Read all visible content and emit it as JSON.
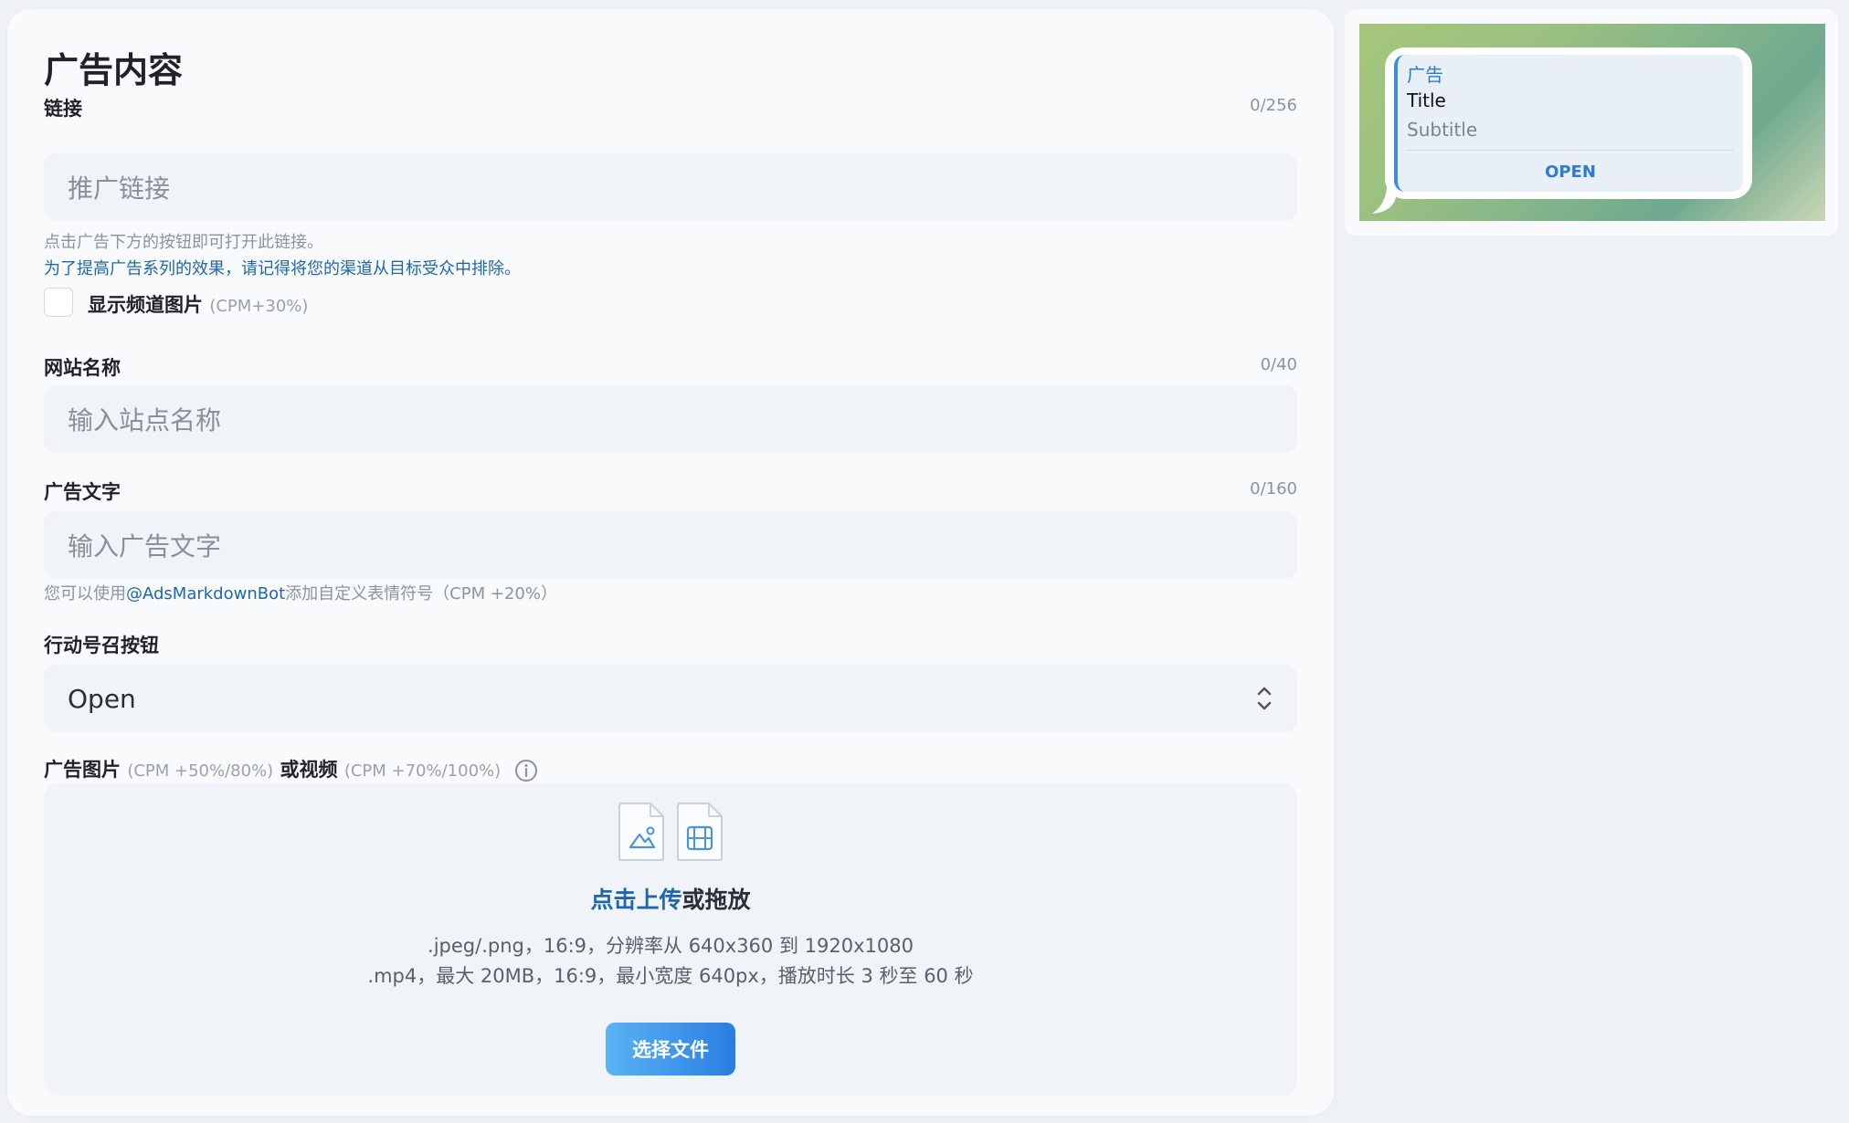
{
  "form": {
    "title": "广告内容",
    "link": {
      "label": "链接",
      "counter": "0/256",
      "placeholder": "推广链接",
      "hint": "点击广告下方的按钮即可打开此链接。",
      "hint_blue": "为了提高广告系列的效果，请记得将您的渠道从目标受众中排除。"
    },
    "show_channel_image": {
      "label": "显示频道图片",
      "cpm": "(CPM+30%)",
      "checked": false
    },
    "site_name": {
      "label": "网站名称",
      "counter": "0/40",
      "placeholder": "输入站点名称"
    },
    "ad_text": {
      "label": "广告文字",
      "counter": "0/160",
      "placeholder": "输入广告文字",
      "hint_prefix": "您可以使用",
      "hint_link": "@AdsMarkdownBot",
      "hint_suffix": "添加自定义表情符号（CPM +20%）"
    },
    "cta": {
      "label": "行动号召按钮",
      "selected": "Open"
    },
    "media": {
      "label_image": "广告图片",
      "cpm_image": "(CPM +50%/80%)",
      "label_or_video": "或视频",
      "cpm_video": "(CPM +70%/100%)",
      "upload_link": "点击上传",
      "upload_suffix": "或拖放",
      "line1": ".jpeg/.png，16:9，分辨率从 640x360 到 1920x1080",
      "line2": ".mp4，最大 20MB，16:9，最小宽度 640px，播放时长 3 秒至 60 秒",
      "button": "选择文件"
    }
  },
  "preview": {
    "ad_label": "广告",
    "title": "Title",
    "subtitle": "Subtitle",
    "button": "OPEN"
  },
  "colors": {
    "accent": "#1f67ad",
    "preview_accent": "#2c7ad6",
    "button_gradient_start": "#5ab4f4",
    "button_gradient_end": "#2a7de1"
  },
  "icons": {
    "info": "info-circle-icon",
    "image_file": "image-file-icon",
    "video_file": "video-file-icon",
    "select": "chevron-updown-icon"
  }
}
